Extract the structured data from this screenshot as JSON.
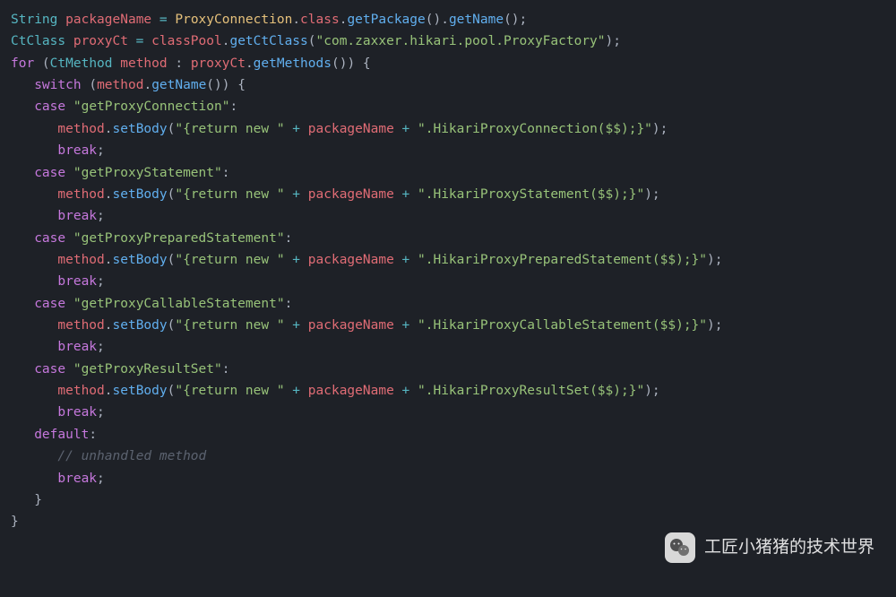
{
  "code": {
    "l1_type1": "String",
    "l1_var1": "packageName",
    "l1_eq": " = ",
    "l1_class": "ProxyConnection",
    "l1_dot1": ".",
    "l1_prop": "class",
    "l1_dot2": ".",
    "l1_m1": "getPackage",
    "l1_p1": "().",
    "l1_m2": "getName",
    "l1_p2": "();",
    "l2_type": "CtClass",
    "l2_var": "proxyCt",
    "l2_eq": " = ",
    "l2_var2": "classPool",
    "l2_dot": ".",
    "l2_m": "getCtClass",
    "l2_p1": "(",
    "l2_str": "\"com.zaxxer.hikari.pool.ProxyFactory\"",
    "l2_p2": ");",
    "l3_for": "for",
    "l3_p1": " (",
    "l3_type": "CtMethod",
    "l3_var1": " method",
    "l3_colon": " : ",
    "l3_var2": "proxyCt",
    "l3_dot": ".",
    "l3_m": "getMethods",
    "l3_p2": "()) {",
    "l4_sw": "switch",
    "l4_p1": " (",
    "l4_var": "method",
    "l4_dot": ".",
    "l4_m": "getName",
    "l4_p2": "()) {",
    "case1_kw": "case",
    "case1_str": "\"getProxyConnection\"",
    "case1_colon": ":",
    "body_var": "method",
    "body_dot": ".",
    "body_m": "setBody",
    "body_p1": "(",
    "body_str1": "\"{return new \"",
    "body_plus1": " + ",
    "body_pkg": "packageName",
    "body_plus2": " + ",
    "body1_str2": "\".HikariProxyConnection($$);}\"",
    "body_p2": ");",
    "break_kw": "break",
    "break_semi": ";",
    "case2_str": "\"getProxyStatement\"",
    "body2_str2": "\".HikariProxyStatement($$);}\"",
    "case3_str": "\"getProxyPreparedStatement\"",
    "body3_str2": "\".HikariProxyPreparedStatement($$);}\"",
    "case4_str": "\"getProxyCallableStatement\"",
    "body4_str2": "\".HikariProxyCallableStatement($$);}\"",
    "case5_str": "\"getProxyResultSet\"",
    "body5_str2": "\".HikariProxyResultSet($$);}\"",
    "default_kw": "default",
    "default_colon": ":",
    "comment": "// unhandled method",
    "close_brace": "}"
  },
  "watermark": {
    "text": "工匠小猪猪的技术世界"
  }
}
